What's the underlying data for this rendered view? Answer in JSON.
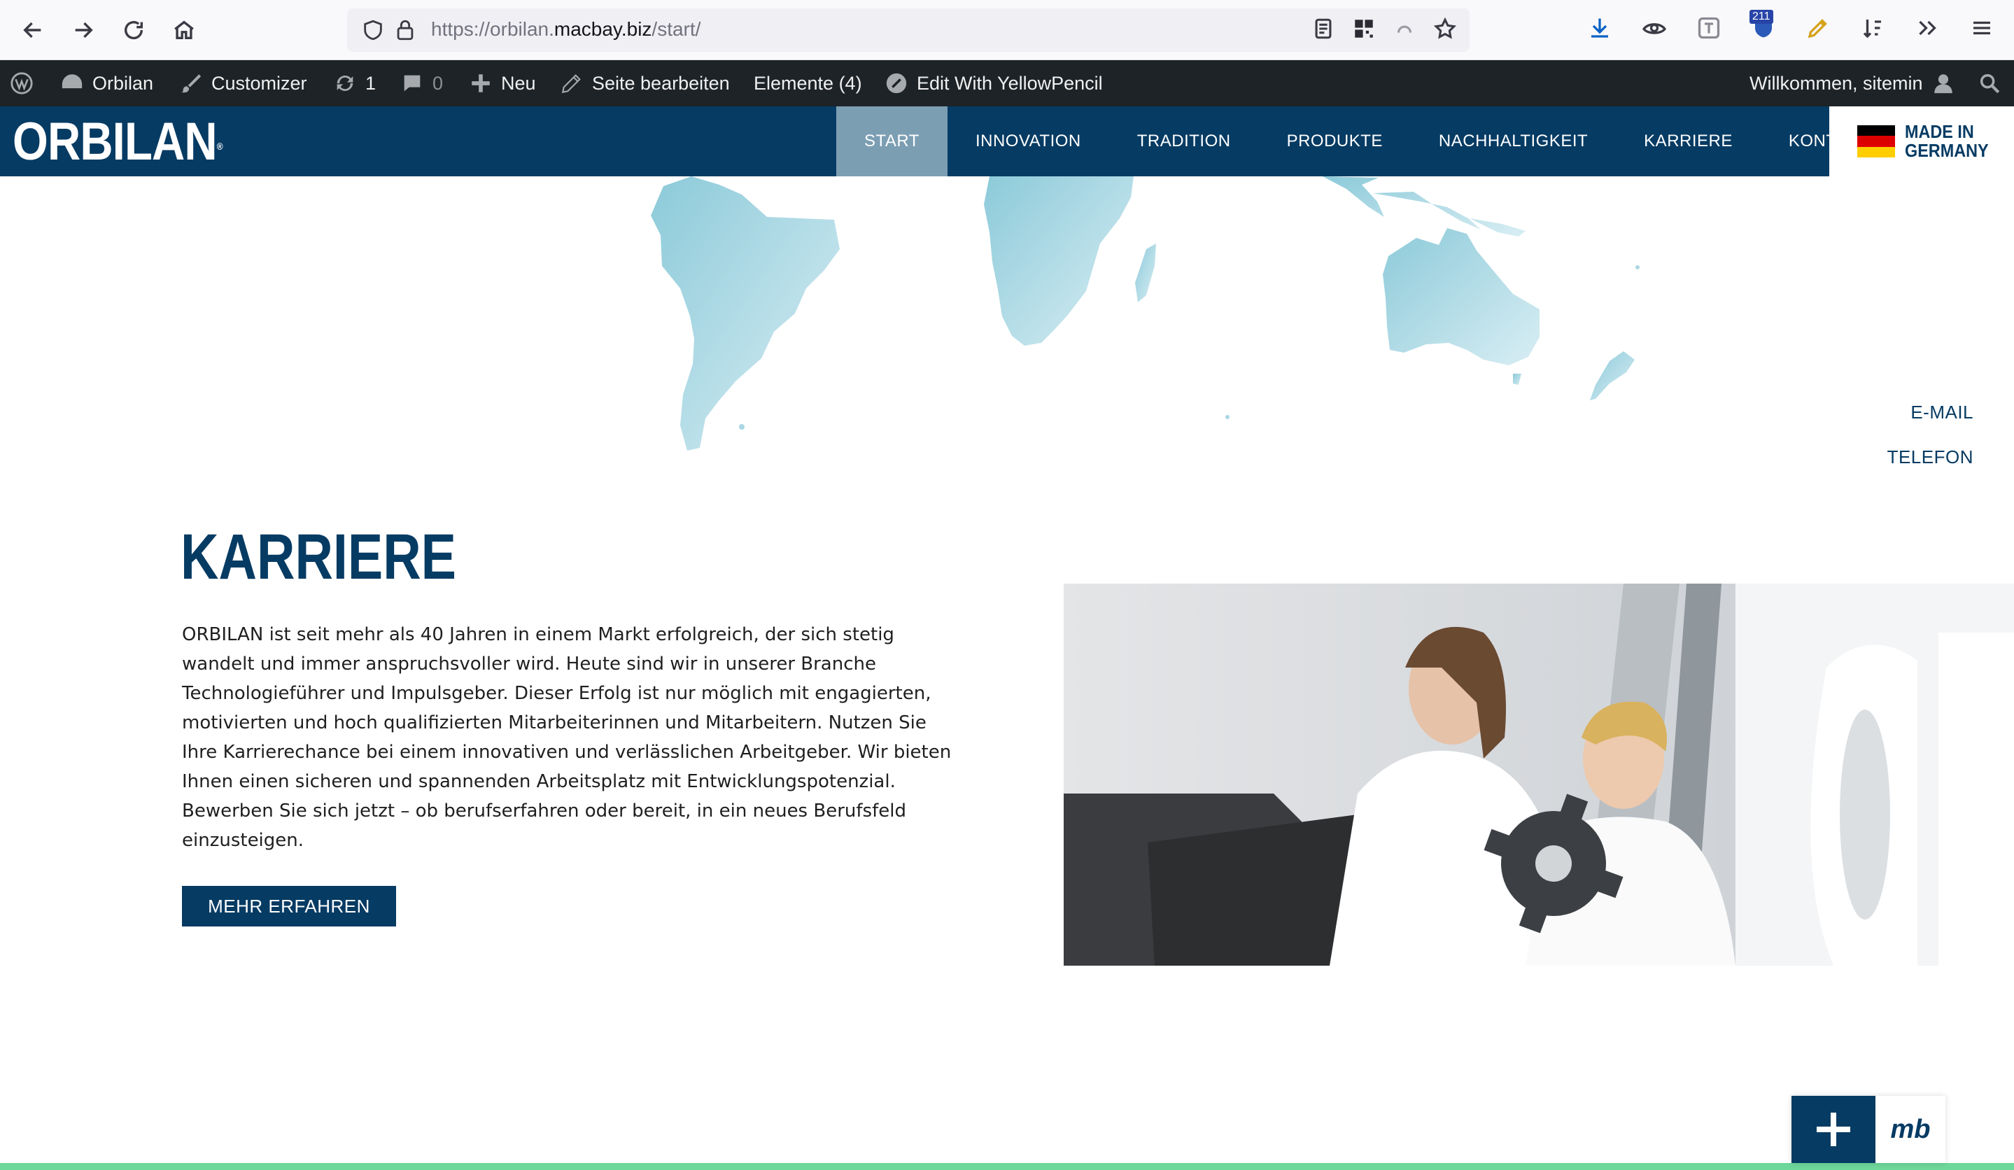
{
  "browser": {
    "url_prefix": "https://orbilan.",
    "url_host": "macbay.biz",
    "url_path": "/start/",
    "extension_badge": "211"
  },
  "wp_admin_bar": {
    "site_name": "Orbilan",
    "customizer": "Customizer",
    "updates_count": "1",
    "comments_count": "0",
    "new_label": "Neu",
    "edit_page": "Seite bearbeiten",
    "elements": "Elemente (4)",
    "yellowpencil": "Edit With YellowPencil",
    "welcome": "Willkommen, sitemin"
  },
  "header": {
    "logo": "ORBILAN",
    "logo_mark": "®",
    "nav": [
      "START",
      "INNOVATION",
      "TRADITION",
      "PRODUKTE",
      "NACHHALTIGKEIT",
      "KARRIERE",
      "KONTAKT"
    ],
    "active_index": 0,
    "made_in_line1": "MADE IN",
    "made_in_line2": "GERMANY"
  },
  "contact": {
    "email": "E-MAIL",
    "phone": "TELEFON"
  },
  "career": {
    "title": "KARRIERE",
    "text": "ORBILAN ist seit mehr als 40 Jahren in einem Markt erfolgreich, der sich stetig wandelt und immer anspruchsvoller wird. Heute sind wir in unserer Branche Technologieführer und Impulsgeber. Dieser Erfolg ist nur möglich mit engagierten, motivierten und hoch qualifizierten Mitarbeiterinnen und Mitarbeitern. Nutzen Sie Ihre Karrierechance bei einem innovativen und verlässlichen Arbeitgeber. Wir bieten Ihnen einen sicheren und spannenden Arbeitsplatz mit Entwicklungspotenzial. Bewerben Sie sich jetzt – ob berufserfahren oder bereit, in ein neues Berufsfeld einzusteigen.",
    "button": "MEHR ERFAHREN"
  },
  "fab": {
    "logo": "mb"
  },
  "colors": {
    "brand_navy": "#063b63",
    "nav_active": "#7c9eb3",
    "wp_bar": "#1d2327",
    "accent_green": "#6ed79a",
    "map_blue": "#a9d7e3"
  }
}
